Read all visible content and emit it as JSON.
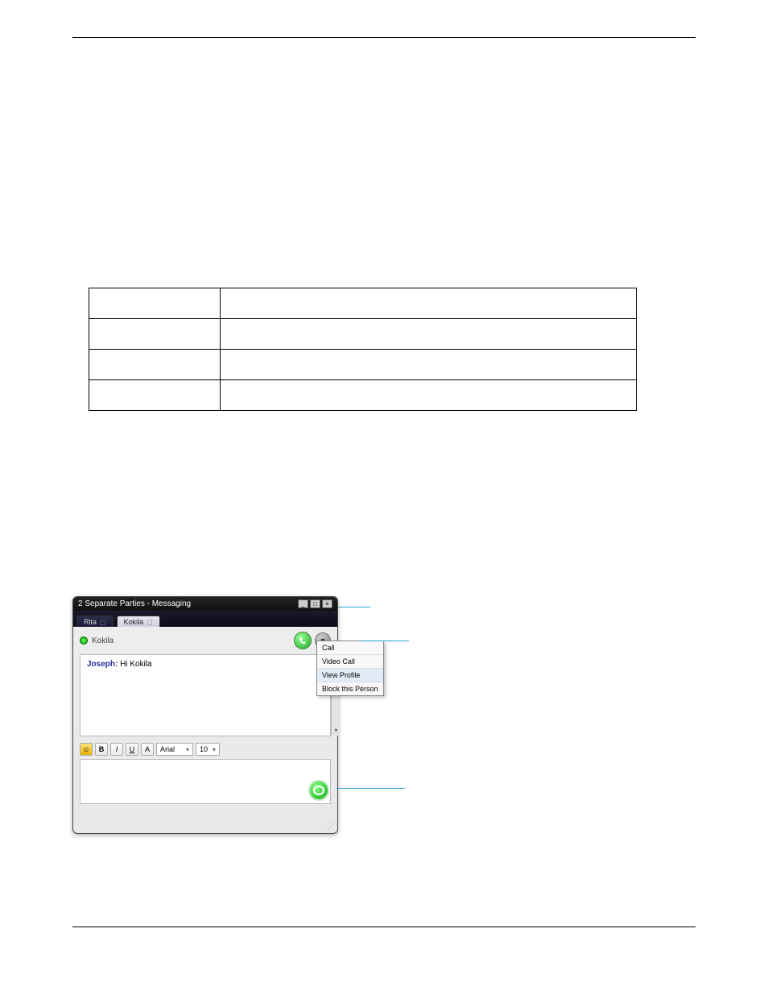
{
  "header": {
    "left": "",
    "right": ""
  },
  "table": {
    "rows": [
      {
        "c0": "",
        "c1": ""
      },
      {
        "c0": "",
        "c1": ""
      },
      {
        "c0": "",
        "c1": ""
      },
      {
        "c0": "",
        "c1": ""
      }
    ]
  },
  "messaging": {
    "window_title": "2 Separate Parties - Messaging",
    "tabs": [
      {
        "label": "Rita",
        "active": false
      },
      {
        "label": "Kokila",
        "active": true
      }
    ],
    "contact_name": "Kokila",
    "message_author": "Joseph:",
    "message_text": "Hi Kokila",
    "context_menu": [
      "Call",
      "Video Call",
      "View Profile",
      "Block this Person"
    ],
    "format": {
      "font": "Arial",
      "size": "10"
    }
  },
  "annotations": {
    "tabs_label": "",
    "view_profile_label": "",
    "send_label": ""
  },
  "footer": {
    "left": "",
    "right": ""
  }
}
